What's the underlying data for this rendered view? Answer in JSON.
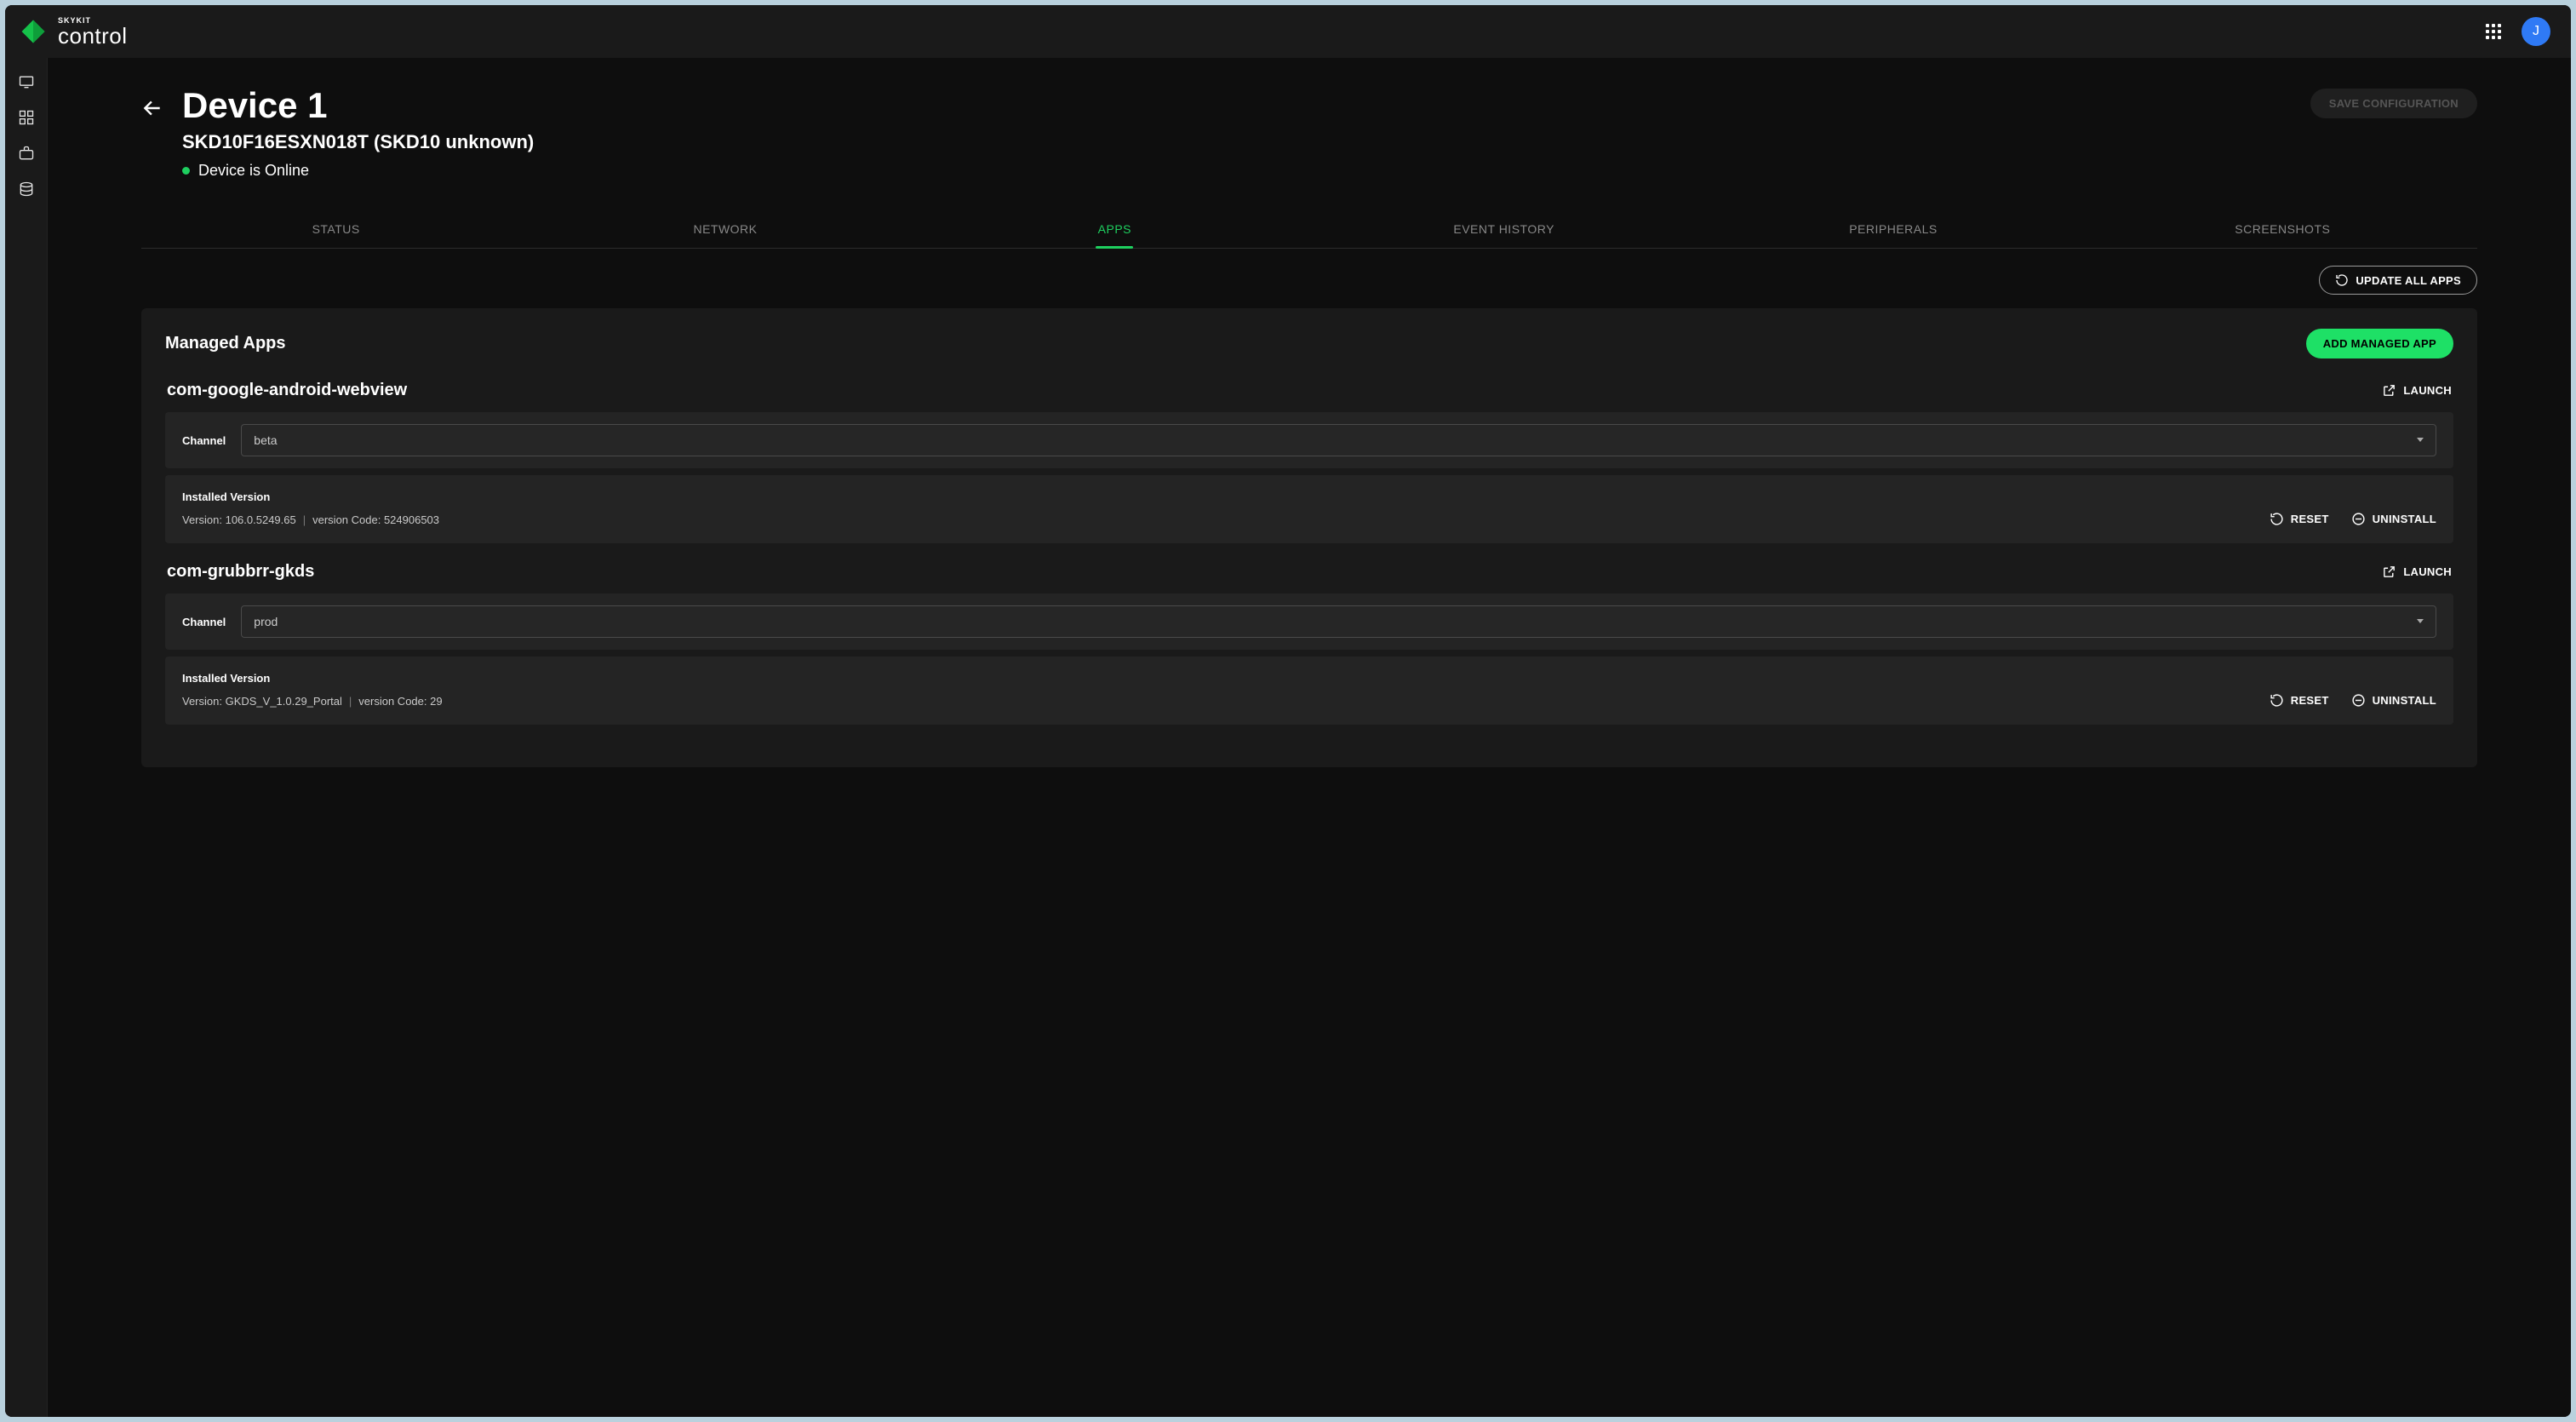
{
  "brand": {
    "super": "SKYKIT",
    "main": "control",
    "avatar_initial": "J"
  },
  "page": {
    "title": "Device 1",
    "subtitle": "SKD10F16ESXN018T (SKD10 unknown)",
    "status_text": "Device is Online",
    "save_button": "SAVE CONFIGURATION"
  },
  "tabs": {
    "items": [
      "STATUS",
      "NETWORK",
      "APPS",
      "EVENT HISTORY",
      "PERIPHERALS",
      "SCREENSHOTS"
    ],
    "active_index": 2
  },
  "actions": {
    "update_all": "UPDATE ALL APPS"
  },
  "panel": {
    "title": "Managed Apps",
    "add_button": "ADD MANAGED APP",
    "channel_label": "Channel",
    "installed_label": "Installed Version",
    "version_prefix": "Version: ",
    "versioncode_prefix": "version Code: ",
    "launch_label": "LAUNCH",
    "reset_label": "RESET",
    "uninstall_label": "UNINSTALL"
  },
  "apps": [
    {
      "name": "com-google-android-webview",
      "channel": "beta",
      "version": "106.0.5249.65",
      "version_code": "524906503"
    },
    {
      "name": "com-grubbrr-gkds",
      "channel": "prod",
      "version": "GKDS_V_1.0.29_Portal",
      "version_code": "29"
    }
  ]
}
